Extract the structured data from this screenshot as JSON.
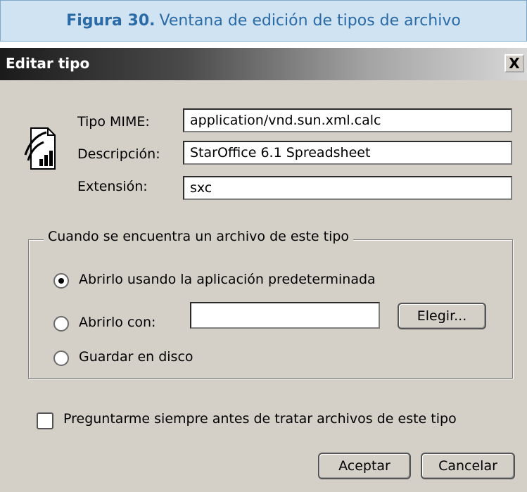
{
  "caption": {
    "bold": "Figura 30.",
    "text": "Ventana de edición de tipos de archivo"
  },
  "dialog": {
    "title": "Editar tipo",
    "close_label": "X",
    "fields": {
      "mime_label": "Tipo MIME:",
      "mime_value": "application/vnd.sun.xml.calc",
      "desc_label": "Descripción:",
      "desc_value": "StarOffice 6.1 Spreadsheet",
      "ext_label": "Extensión:",
      "ext_value": "sxc"
    },
    "group": {
      "legend": "Cuando se encuentra un archivo de este tipo",
      "options": [
        {
          "label": "Abrirlo usando la aplicación predeterminada",
          "selected": true
        },
        {
          "label": "Abrirlo con:",
          "selected": false
        },
        {
          "label": "Guardar en disco",
          "selected": false
        }
      ],
      "open_with_value": "",
      "choose_button": "Elegir..."
    },
    "always_ask": {
      "label": "Preguntarme siempre antes de tratar archivos de este tipo",
      "checked": false
    },
    "buttons": {
      "ok": "Aceptar",
      "cancel": "Cancelar"
    },
    "icon": "spreadsheet-document-icon"
  }
}
